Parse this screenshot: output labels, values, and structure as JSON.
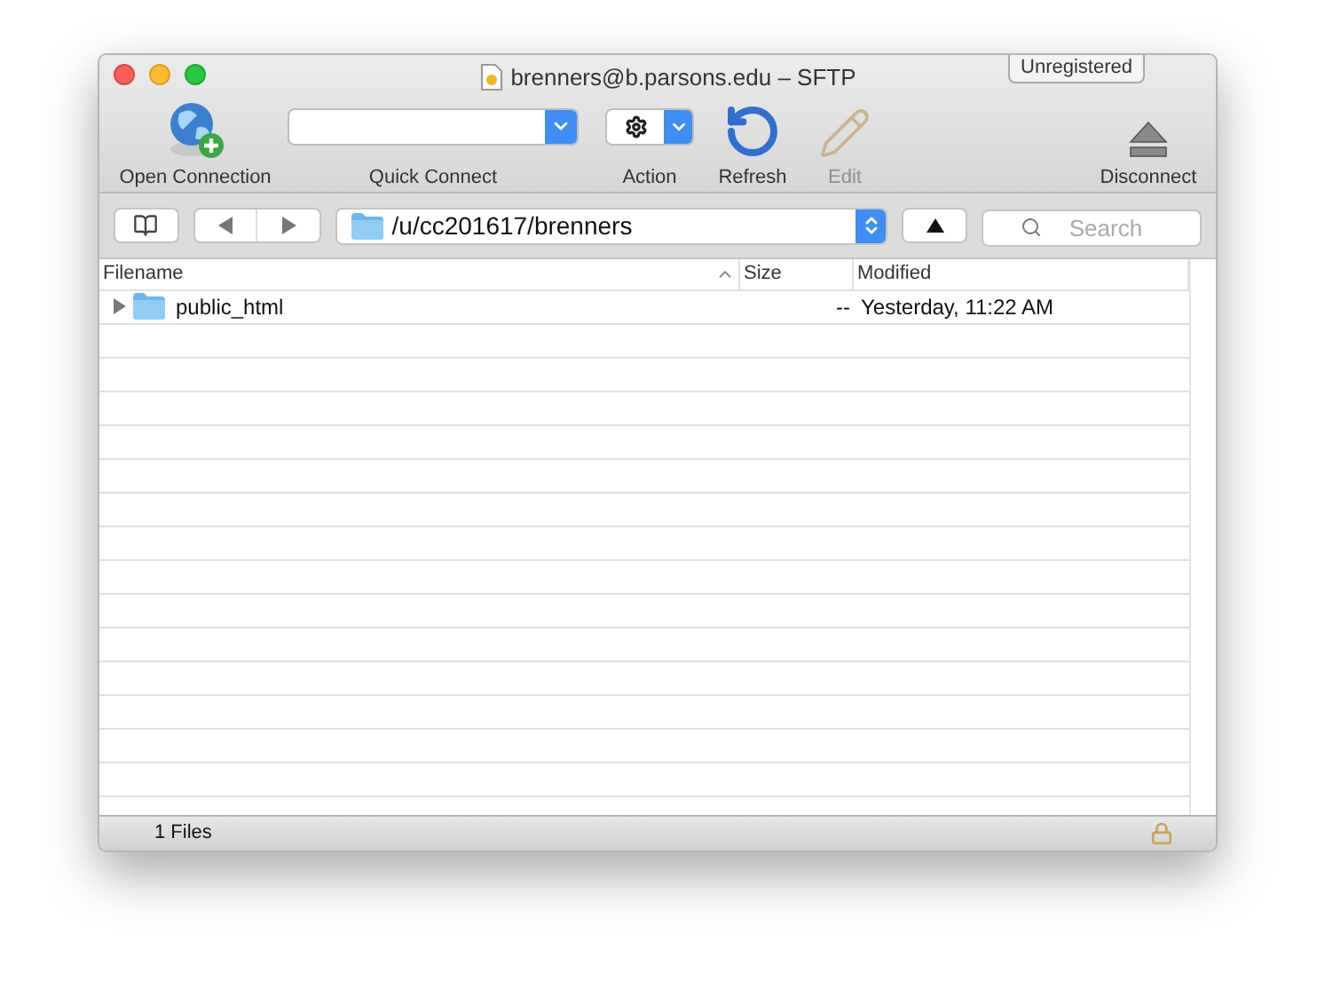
{
  "window": {
    "title": "brenners@b.parsons.edu – SFTP",
    "badge": "Unregistered"
  },
  "toolbar": [
    {
      "kind": "open",
      "label": "Open Connection",
      "disabled": false
    },
    {
      "kind": "combo",
      "label": "Quick Connect",
      "disabled": false
    },
    {
      "kind": "action",
      "label": "Action",
      "disabled": false
    },
    {
      "kind": "refresh",
      "label": "Refresh",
      "disabled": false
    },
    {
      "kind": "edit",
      "label": "Edit",
      "disabled": true
    },
    {
      "kind": "disconnect",
      "label": "Disconnect",
      "disabled": false
    }
  ],
  "path_bar": {
    "path": "/u/cc201617/brenners",
    "search": {
      "placeholder": "Search"
    }
  },
  "table": {
    "columns": [
      {
        "label": "Filename",
        "sorted": true
      },
      {
        "label": "Size",
        "sorted": false
      },
      {
        "label": "Modified",
        "sorted": false
      }
    ],
    "rows": [
      {
        "name": "public_html",
        "kind": "folder",
        "expanded": false,
        "size": "--",
        "modified": "Yesterday, 11:22 AM"
      }
    ]
  },
  "status_bar": {
    "text": "1 Files",
    "locked": true
  }
}
